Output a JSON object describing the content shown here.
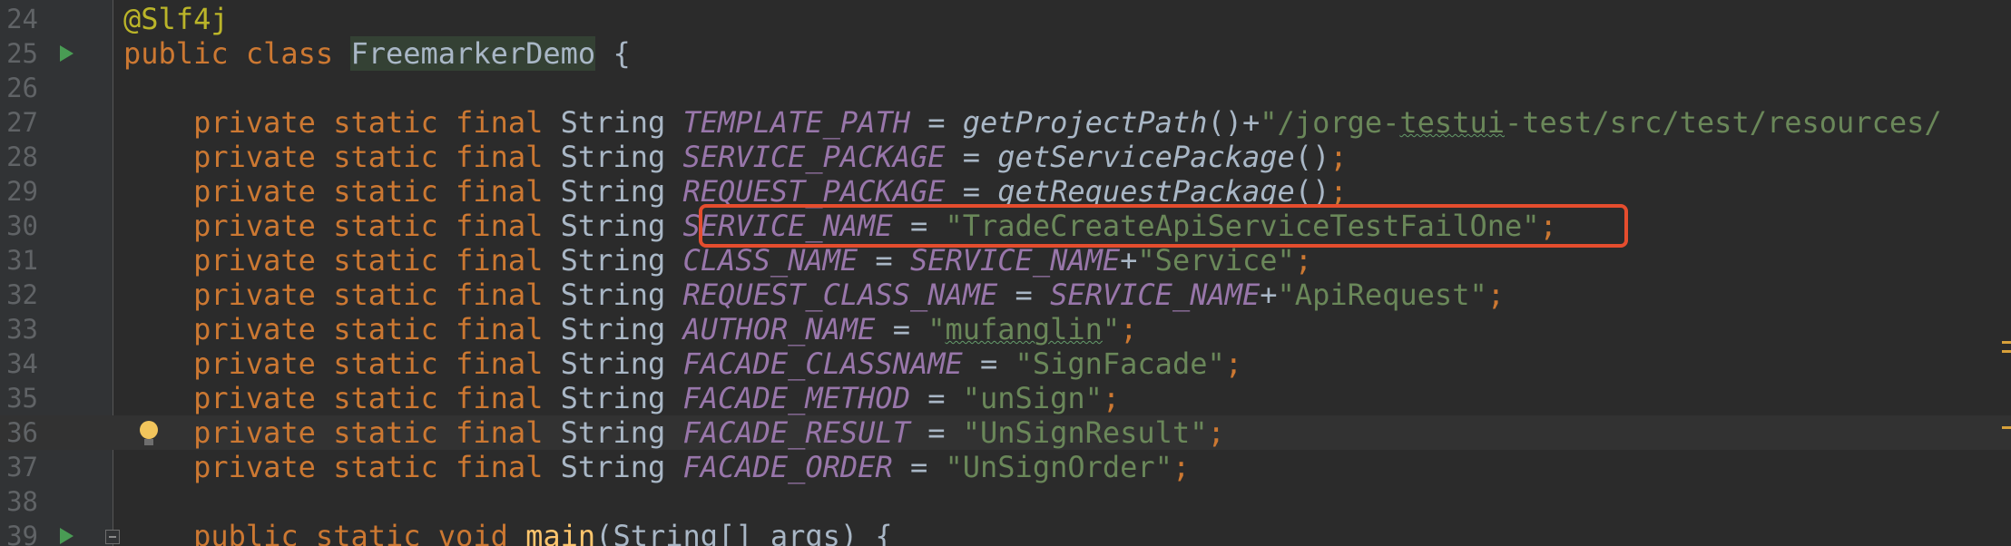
{
  "editor": {
    "lines": [
      {
        "number": "24",
        "tokens": [
          {
            "t": "@Slf4j",
            "c": "ann"
          }
        ]
      },
      {
        "number": "25",
        "tokens": [
          {
            "t": "public",
            "c": "kw"
          },
          {
            "t": " ",
            "c": "op"
          },
          {
            "t": "class",
            "c": "kw"
          },
          {
            "t": " ",
            "c": "op"
          },
          {
            "t": "FreemarkerDemo",
            "c": "classname"
          },
          {
            "t": " {",
            "c": "op"
          }
        ]
      },
      {
        "number": "26",
        "tokens": []
      },
      {
        "number": "27",
        "tokens": [
          {
            "t": "    private",
            "c": "kw"
          },
          {
            "t": " ",
            "c": "op"
          },
          {
            "t": "static",
            "c": "kw"
          },
          {
            "t": " ",
            "c": "op"
          },
          {
            "t": "final",
            "c": "kw"
          },
          {
            "t": " String ",
            "c": "type"
          },
          {
            "t": "TEMPLATE_PATH",
            "c": "const"
          },
          {
            "t": " = ",
            "c": "op"
          },
          {
            "t": "getProjectPath",
            "c": "method"
          },
          {
            "t": "()+",
            "c": "op"
          },
          {
            "t": "\"/jorge-",
            "c": "str"
          },
          {
            "t": "testui",
            "c": "str typo"
          },
          {
            "t": "-test/src/test/resources/",
            "c": "str"
          }
        ]
      },
      {
        "number": "28",
        "tokens": [
          {
            "t": "    private",
            "c": "kw"
          },
          {
            "t": " ",
            "c": "op"
          },
          {
            "t": "static",
            "c": "kw"
          },
          {
            "t": " ",
            "c": "op"
          },
          {
            "t": "final",
            "c": "kw"
          },
          {
            "t": " String ",
            "c": "type"
          },
          {
            "t": "SERVICE_PACKAGE",
            "c": "const"
          },
          {
            "t": " = ",
            "c": "op"
          },
          {
            "t": "getServicePackage",
            "c": "method"
          },
          {
            "t": "()",
            "c": "op"
          },
          {
            "t": ";",
            "c": "punct"
          }
        ]
      },
      {
        "number": "29",
        "tokens": [
          {
            "t": "    private",
            "c": "kw"
          },
          {
            "t": " ",
            "c": "op"
          },
          {
            "t": "static",
            "c": "kw"
          },
          {
            "t": " ",
            "c": "op"
          },
          {
            "t": "final",
            "c": "kw"
          },
          {
            "t": " String ",
            "c": "type"
          },
          {
            "t": "REQUEST_PACKAGE",
            "c": "const"
          },
          {
            "t": " = ",
            "c": "op"
          },
          {
            "t": "getRequestPackage",
            "c": "method"
          },
          {
            "t": "()",
            "c": "op"
          },
          {
            "t": ";",
            "c": "punct"
          }
        ]
      },
      {
        "number": "30",
        "tokens": [
          {
            "t": "    private",
            "c": "kw"
          },
          {
            "t": " ",
            "c": "op"
          },
          {
            "t": "static",
            "c": "kw"
          },
          {
            "t": " ",
            "c": "op"
          },
          {
            "t": "final",
            "c": "kw"
          },
          {
            "t": " String ",
            "c": "type"
          },
          {
            "t": "SERVICE_NAME",
            "c": "const"
          },
          {
            "t": " = ",
            "c": "op"
          },
          {
            "t": "\"TradeCreateApiServiceTestFailOne\"",
            "c": "str"
          },
          {
            "t": ";",
            "c": "punct"
          }
        ]
      },
      {
        "number": "31",
        "tokens": [
          {
            "t": "    private",
            "c": "kw"
          },
          {
            "t": " ",
            "c": "op"
          },
          {
            "t": "static",
            "c": "kw"
          },
          {
            "t": " ",
            "c": "op"
          },
          {
            "t": "final",
            "c": "kw"
          },
          {
            "t": " String ",
            "c": "type"
          },
          {
            "t": "CLASS_NAME",
            "c": "const"
          },
          {
            "t": " = ",
            "c": "op"
          },
          {
            "t": "SERVICE_NAME",
            "c": "const"
          },
          {
            "t": "+",
            "c": "op"
          },
          {
            "t": "\"Service\"",
            "c": "str"
          },
          {
            "t": ";",
            "c": "punct"
          }
        ]
      },
      {
        "number": "32",
        "tokens": [
          {
            "t": "    private",
            "c": "kw"
          },
          {
            "t": " ",
            "c": "op"
          },
          {
            "t": "static",
            "c": "kw"
          },
          {
            "t": " ",
            "c": "op"
          },
          {
            "t": "final",
            "c": "kw"
          },
          {
            "t": " String ",
            "c": "type"
          },
          {
            "t": "REQUEST_CLASS_NAME",
            "c": "const"
          },
          {
            "t": " = ",
            "c": "op"
          },
          {
            "t": "SERVICE_NAME",
            "c": "const"
          },
          {
            "t": "+",
            "c": "op"
          },
          {
            "t": "\"ApiRequest\"",
            "c": "str"
          },
          {
            "t": ";",
            "c": "punct"
          }
        ]
      },
      {
        "number": "33",
        "tokens": [
          {
            "t": "    private",
            "c": "kw"
          },
          {
            "t": " ",
            "c": "op"
          },
          {
            "t": "static",
            "c": "kw"
          },
          {
            "t": " ",
            "c": "op"
          },
          {
            "t": "final",
            "c": "kw"
          },
          {
            "t": " String ",
            "c": "type"
          },
          {
            "t": "AUTHOR_NAME",
            "c": "const"
          },
          {
            "t": " = ",
            "c": "op"
          },
          {
            "t": "\"",
            "c": "str"
          },
          {
            "t": "mufanglin",
            "c": "str typo"
          },
          {
            "t": "\"",
            "c": "str"
          },
          {
            "t": ";",
            "c": "punct"
          }
        ]
      },
      {
        "number": "34",
        "tokens": [
          {
            "t": "    private",
            "c": "kw"
          },
          {
            "t": " ",
            "c": "op"
          },
          {
            "t": "static",
            "c": "kw"
          },
          {
            "t": " ",
            "c": "op"
          },
          {
            "t": "final",
            "c": "kw"
          },
          {
            "t": " String ",
            "c": "type"
          },
          {
            "t": "FACADE_CLASSNAME",
            "c": "const"
          },
          {
            "t": " = ",
            "c": "op"
          },
          {
            "t": "\"SignFacade\"",
            "c": "str"
          },
          {
            "t": ";",
            "c": "punct"
          }
        ]
      },
      {
        "number": "35",
        "tokens": [
          {
            "t": "    private",
            "c": "kw"
          },
          {
            "t": " ",
            "c": "op"
          },
          {
            "t": "static",
            "c": "kw"
          },
          {
            "t": " ",
            "c": "op"
          },
          {
            "t": "final",
            "c": "kw"
          },
          {
            "t": " String ",
            "c": "type"
          },
          {
            "t": "FACADE_METHOD",
            "c": "const"
          },
          {
            "t": " = ",
            "c": "op"
          },
          {
            "t": "\"unSign\"",
            "c": "str"
          },
          {
            "t": ";",
            "c": "punct"
          }
        ]
      },
      {
        "number": "36",
        "tokens": [
          {
            "t": "    private",
            "c": "kw"
          },
          {
            "t": " ",
            "c": "op"
          },
          {
            "t": "static",
            "c": "kw"
          },
          {
            "t": " ",
            "c": "op"
          },
          {
            "t": "final",
            "c": "kw"
          },
          {
            "t": " String ",
            "c": "type"
          },
          {
            "t": "FACADE_RESULT",
            "c": "const"
          },
          {
            "t": " = ",
            "c": "op"
          },
          {
            "t": "\"UnSignResult\"",
            "c": "str"
          },
          {
            "t": ";",
            "c": "punct"
          }
        ]
      },
      {
        "number": "37",
        "tokens": [
          {
            "t": "    private",
            "c": "kw"
          },
          {
            "t": " ",
            "c": "op"
          },
          {
            "t": "static",
            "c": "kw"
          },
          {
            "t": " ",
            "c": "op"
          },
          {
            "t": "final",
            "c": "kw"
          },
          {
            "t": " String ",
            "c": "type"
          },
          {
            "t": "FACADE_ORDER",
            "c": "const"
          },
          {
            "t": " = ",
            "c": "op"
          },
          {
            "t": "\"UnSignOrder\"",
            "c": "str"
          },
          {
            "t": ";",
            "c": "punct"
          }
        ]
      },
      {
        "number": "38",
        "tokens": []
      },
      {
        "number": "39",
        "tokens": [
          {
            "t": "    public",
            "c": "kw"
          },
          {
            "t": " ",
            "c": "op"
          },
          {
            "t": "static",
            "c": "kw"
          },
          {
            "t": " ",
            "c": "op"
          },
          {
            "t": "void",
            "c": "kw"
          },
          {
            "t": " ",
            "c": "op"
          },
          {
            "t": "main",
            "c": "methoddecl"
          },
          {
            "t": "(String[] args) {",
            "c": "op"
          }
        ]
      }
    ],
    "current_line": "36",
    "highlighted_line": "30",
    "gutter_icons": [
      {
        "line": "25",
        "icon": "run-icon"
      },
      {
        "line": "36",
        "icon": "lightbulb-icon"
      },
      {
        "line": "39",
        "icon": "run-icon"
      },
      {
        "line": "39",
        "icon": "fold-icon"
      }
    ],
    "colors": {
      "background": "#2b2b2b",
      "keyword": "#cc7832",
      "constant": "#9876aa",
      "string": "#6a8759",
      "annotation": "#bbb529",
      "highlight_box": "#e54d2e"
    }
  }
}
